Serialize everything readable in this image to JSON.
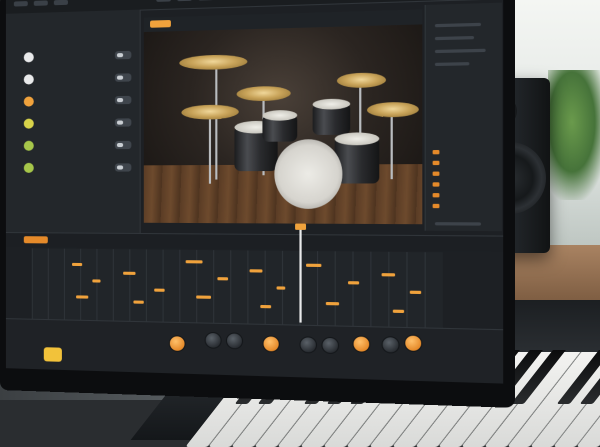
{
  "scene": {
    "subject": "",
    "monitor": {},
    "speaker": {},
    "keyboard": {}
  },
  "colors": {
    "accent": "#f0a23c",
    "panel": "#262a2f",
    "background": "#1d2024"
  },
  "sidebar": {
    "tracks": [
      {
        "icon": "white-circle-icon",
        "color": "#e9eaeb"
      },
      {
        "icon": "white-circle-icon",
        "color": "#e9eaeb"
      },
      {
        "icon": "orange-circle-icon",
        "color": "#f0a23c"
      },
      {
        "icon": "yellow-circle-icon",
        "color": "#d8d34a"
      },
      {
        "icon": "green-circle-icon",
        "color": "#a6c64a"
      },
      {
        "icon": "green-circle-icon",
        "color": "#a6c64a"
      }
    ]
  }
}
